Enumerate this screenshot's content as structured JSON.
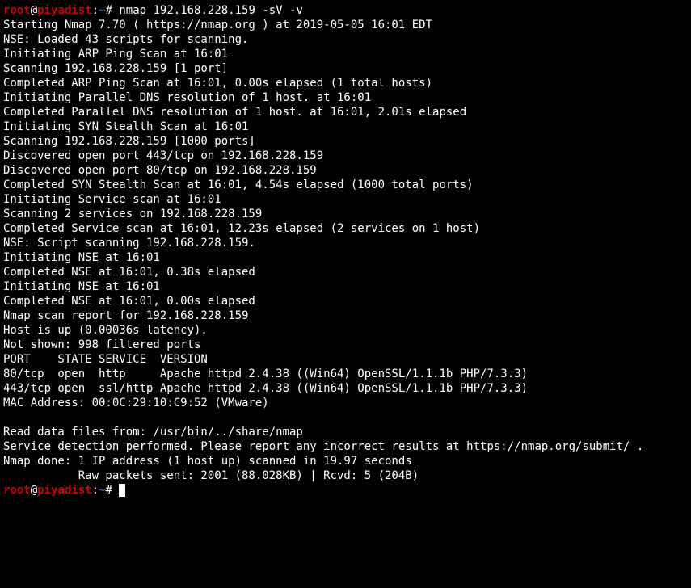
{
  "prompt1": {
    "user": "root",
    "host": "piyadist",
    "path": "~",
    "symbol": "#",
    "command": "nmap 192.168.228.159 -sV -v"
  },
  "prompt2": {
    "user": "root",
    "host": "piyadist",
    "path": "~",
    "symbol": "#"
  },
  "output": {
    "l0": "Starting Nmap 7.70 ( https://nmap.org ) at 2019-05-05 16:01 EDT",
    "l1": "NSE: Loaded 43 scripts for scanning.",
    "l2": "Initiating ARP Ping Scan at 16:01",
    "l3": "Scanning 192.168.228.159 [1 port]",
    "l4": "Completed ARP Ping Scan at 16:01, 0.00s elapsed (1 total hosts)",
    "l5": "Initiating Parallel DNS resolution of 1 host. at 16:01",
    "l6": "Completed Parallel DNS resolution of 1 host. at 16:01, 2.01s elapsed",
    "l7": "Initiating SYN Stealth Scan at 16:01",
    "l8": "Scanning 192.168.228.159 [1000 ports]",
    "l9": "Discovered open port 443/tcp on 192.168.228.159",
    "l10": "Discovered open port 80/tcp on 192.168.228.159",
    "l11": "Completed SYN Stealth Scan at 16:01, 4.54s elapsed (1000 total ports)",
    "l12": "Initiating Service scan at 16:01",
    "l13": "Scanning 2 services on 192.168.228.159",
    "l14": "Completed Service scan at 16:01, 12.23s elapsed (2 services on 1 host)",
    "l15": "NSE: Script scanning 192.168.228.159.",
    "l16": "Initiating NSE at 16:01",
    "l17": "Completed NSE at 16:01, 0.38s elapsed",
    "l18": "Initiating NSE at 16:01",
    "l19": "Completed NSE at 16:01, 0.00s elapsed",
    "l20": "Nmap scan report for 192.168.228.159",
    "l21": "Host is up (0.00036s latency).",
    "l22": "Not shown: 998 filtered ports",
    "l23": "PORT    STATE SERVICE  VERSION",
    "l24": "80/tcp  open  http     Apache httpd 2.4.38 ((Win64) OpenSSL/1.1.1b PHP/7.3.3)",
    "l25": "443/tcp open  ssl/http Apache httpd 2.4.38 ((Win64) OpenSSL/1.1.1b PHP/7.3.3)",
    "l26": "MAC Address: 00:0C:29:10:C9:52 (VMware)",
    "l27": "Read data files from: /usr/bin/../share/nmap",
    "l28": "Service detection performed. Please report any incorrect results at https://nmap.org/submit/ .",
    "l29": "Nmap done: 1 IP address (1 host up) scanned in 19.97 seconds",
    "l30": "           Raw packets sent: 2001 (88.028KB) | Rcvd: 5 (204B)"
  }
}
